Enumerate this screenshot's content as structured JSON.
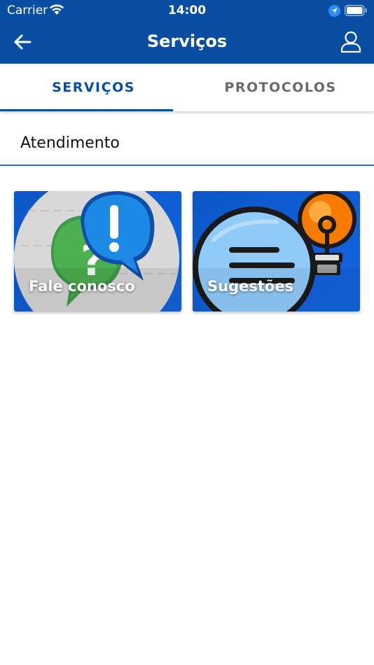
{
  "status_bar": {
    "carrier": "Carrier",
    "time": "14:00",
    "icons": [
      "wifi-icon",
      "location-arrow-icon",
      "battery-icon"
    ]
  },
  "app_bar": {
    "title": "Serviços",
    "back_icon": "arrow-left-icon",
    "profile_icon": "user-icon",
    "background_color": "#0a4ea3"
  },
  "tabs": [
    {
      "label": "SERVIÇOS",
      "active": true
    },
    {
      "label": "PROTOCOLOS",
      "active": false
    }
  ],
  "section": {
    "title": "Atendimento"
  },
  "cards": [
    {
      "label": "Fale conosco",
      "icon": "chat-bubbles-question-exclamation-icon"
    },
    {
      "label": "Sugestões",
      "icon": "chat-bubble-lightbulb-icon"
    }
  ],
  "colors": {
    "primary": "#0a4ea3",
    "tab_inactive": "#6a6a6a",
    "divider": "#2a6fc4"
  }
}
